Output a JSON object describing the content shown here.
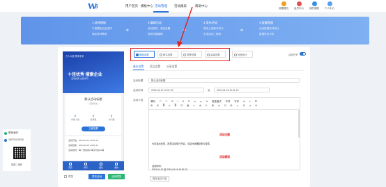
{
  "nav": {
    "logo_letter": "W",
    "logo_number": "8",
    "links": [
      "用户首页",
      "模板中心",
      "活动管理",
      "活动报表",
      "帮助中心"
    ],
    "icons": [
      {
        "label": "设置展位",
        "color": "#f0a020",
        "icon": "booth-icon"
      },
      {
        "label": "会员中心",
        "color": "#e05050",
        "icon": "vip-icon"
      },
      {
        "label": "我的通知",
        "color": "#3a8ee6",
        "icon": "bell-icon"
      },
      {
        "label": "个人中心",
        "color": "#5aa0f0",
        "icon": "user-icon"
      }
    ]
  },
  "banner": {
    "steps": [
      {
        "title": "1.选择模板",
        "desc1": "丰富模板自由选择",
        "desc2": "满足各种需求"
      },
      {
        "title": "2.编辑活动",
        "desc1": "活动规则、奖品设置",
        "desc2": "轻松快捷编辑"
      },
      {
        "title": "3.发布活动",
        "desc1": "发布上线即可参与",
        "desc2": "生成活动二维码"
      },
      {
        "title": "4.查看数据",
        "desc1": "活动数据实时统计",
        "desc2": "数据导出分析"
      }
    ]
  },
  "phone": {
    "header": "万人大奖 等你来拿",
    "hero_title": "十佳优秀 搜索企业",
    "hero_sub": "活动投票 全民参与",
    "name": "默认活动标题",
    "sub": "— 活动状态 —",
    "stats": [
      {
        "value": "0",
        "label": "参赛人数"
      },
      {
        "value": "0",
        "label": "投票数"
      },
      {
        "value": "0",
        "label": "访问量"
      }
    ],
    "vote_button": "立即投票",
    "times": [
      "活动开始：2024-04-12 10:01:22",
      "活动结束：2024-04-15 10:01:22",
      "活动规则：每个微信用户每天可投10票"
    ],
    "tabbar": [
      "首页",
      "排行",
      "报名",
      "我的"
    ]
  },
  "bottom": {
    "checkbox_label": "预览",
    "publish": "发布活动",
    "preview": "活动预览"
  },
  "templates": {
    "items": [
      "基础设置",
      "报名设置",
      "投票设置",
      "高级设置"
    ],
    "extra": "页面设计",
    "toggle_label": "活动开关"
  },
  "subtabs": [
    "基本设置",
    "奖品设置",
    "分享设置"
  ],
  "form": {
    "title_label": "活动标题",
    "title_value": "默认活动标题",
    "time_label": "活动时间",
    "start": "2024-04-12 10:01:22",
    "sep": "至",
    "end": "2024-04-15 10:01:22",
    "content_label": "活动介绍"
  },
  "editor": {
    "toolbar1": [
      "源码",
      "↶",
      "↷",
      "B",
      "I",
      "U",
      "S",
      "x²",
      "x₂",
      "A",
      "段落格式",
      "字体",
      "字号",
      "⊘",
      "≡",
      "☰"
    ],
    "toolbar2": [
      "⊞",
      "⊟",
      "≣",
      "≡",
      "≣",
      "☷",
      "▤",
      "⎌",
      "⊕",
      "✎",
      "⌘",
      "⊙",
      "⊡",
      "⊞",
      "☺",
      "Ω",
      "⊿",
      "⟲"
    ],
    "heading1": "活动主题",
    "line1": "为评选出优秀，投票活动现已开启，欢迎大家踊跃参与投票。",
    "heading2": "活动规则",
    "line2": "活动时间：",
    "line3": "2024-04-12 至 2024-04-15 10:01:22"
  },
  "save_button": "保存活动介绍",
  "contact": {
    "title": "联系我们",
    "phone": "19074110215",
    "caption": "客服二维码"
  }
}
